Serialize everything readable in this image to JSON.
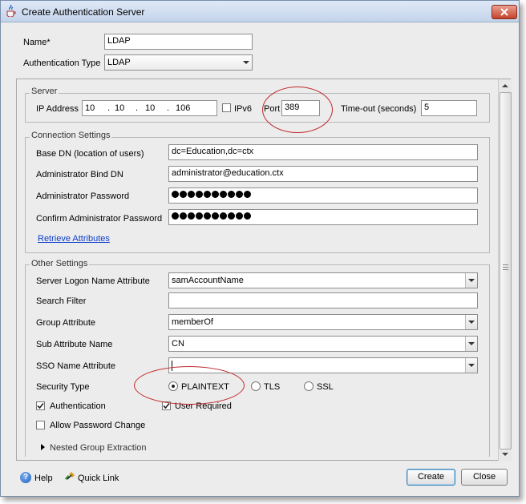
{
  "window": {
    "title": "Create Authentication Server"
  },
  "top": {
    "name_label": "Name*",
    "name_value": "LDAP",
    "auth_type_label": "Authentication Type",
    "auth_type_value": "LDAP"
  },
  "server": {
    "group_title": "Server",
    "ip_label": "IP Address",
    "ip_octets": [
      "10",
      "10",
      "10",
      "106"
    ],
    "ipv6_label": "IPv6",
    "port_label": "Port",
    "port_value": "389",
    "timeout_label": "Time-out (seconds)",
    "timeout_value": "5"
  },
  "connection": {
    "group_title": "Connection Settings",
    "base_dn_label": "Base DN (location of users)",
    "base_dn_value": "dc=Education,dc=ctx",
    "bind_dn_label": "Administrator Bind DN",
    "bind_dn_value": "administrator@education.ctx",
    "password_label": "Administrator Password",
    "confirm_label": "Confirm Administrator Password",
    "retrieve_link": "Retrieve Attributes"
  },
  "other": {
    "group_title": "Other Settings",
    "logon_attr_label": "Server Logon Name Attribute",
    "logon_attr_value": "samAccountName",
    "search_filter_label": "Search Filter",
    "search_filter_value": "",
    "group_attr_label": "Group Attribute",
    "group_attr_value": "memberOf",
    "sub_attr_label": "Sub Attribute Name",
    "sub_attr_value": "CN",
    "sso_attr_label": "SSO Name Attribute",
    "sso_attr_value": "",
    "security_type_label": "Security Type",
    "security_options": [
      "PLAINTEXT",
      "TLS",
      "SSL"
    ],
    "security_selected": "PLAINTEXT",
    "authentication_label": "Authentication",
    "user_required_label": "User Required",
    "allow_pw_change_label": "Allow Password Change",
    "nested_label": "Nested Group Extraction"
  },
  "footer": {
    "help_label": "Help",
    "quicklink_label": "Quick Link",
    "create_label": "Create",
    "close_label": "Close"
  },
  "colors": {
    "annotation_ring": "#c0282a",
    "link": "#0b3dcc"
  }
}
